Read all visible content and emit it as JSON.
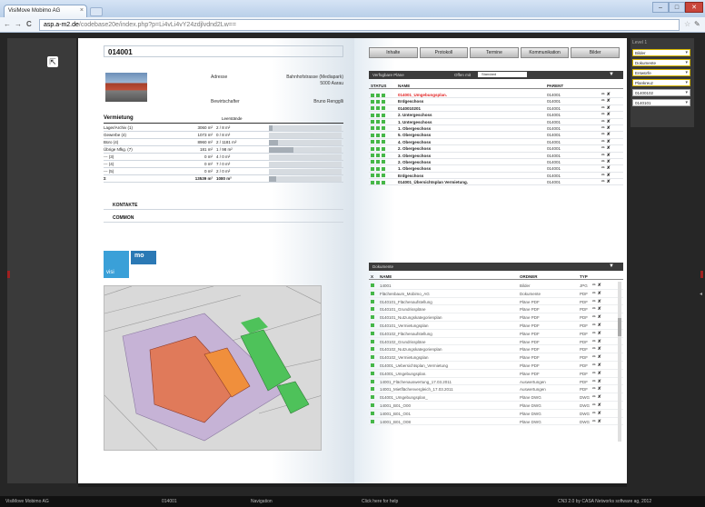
{
  "browser": {
    "tab_title": "VisiMove Mobimo AG",
    "tab_close": "×",
    "url_host": "asp.a-m2.de",
    "url_path": "/codebase20e/index.php?p=Li4vLi4vY24zdjlvdnd2Lw==",
    "back": "←",
    "forward": "→",
    "reload": "C",
    "star": "☆",
    "wrench": "✎",
    "win_min": "–",
    "win_max": "□",
    "win_close": "✕"
  },
  "left": {
    "cursor_icon": "⇱",
    "object_id": "014001",
    "address_label": "Adresse",
    "address_line1": "Bahnhofstrasse (Mediapark)",
    "address_line2": "5000 Aarau",
    "manager_label": "Bewirtschafter",
    "manager_value": "Bruno Rengglli",
    "vermietung_title": "Vermietung",
    "leerstaende_label": "Leerstände",
    "rows": [
      {
        "label": "Lager/Archiv (1)",
        "area": "3060 m²",
        "ratio": "2 / 8 m²",
        "fill": 0.05
      },
      {
        "label": "Gewerbe (4)",
        "area": "1073 m²",
        "ratio": "0 / 8 m²",
        "fill": 0.0
      },
      {
        "label": "Büro (4)",
        "area": "8960 m²",
        "ratio": "2 / 1181 m²",
        "fill": 0.12
      },
      {
        "label": "Übrige Nfkg. (7)",
        "area": "181 m²",
        "ratio": "1 / 98 m²",
        "fill": 0.34
      },
      {
        "label": "--- (3)",
        "area": "0 m²",
        "ratio": "4 / 0 m²",
        "fill": 0.0
      },
      {
        "label": "--- (4)",
        "area": "0 m²",
        "ratio": "7 / 0 m²",
        "fill": 0.0
      },
      {
        "label": "--- (5)",
        "area": "0 m²",
        "ratio": "2 / 0 m²",
        "fill": 0.0
      }
    ],
    "total": {
      "label": "Σ",
      "area": "13539 m²",
      "ratio": "1080 m²",
      "fill": 0.1
    },
    "kontakte": "KONTAKTE",
    "common": "COMMON",
    "logo_top": "mo",
    "logo_bottom": "visi"
  },
  "toolbar": [
    "Inhalte",
    "Protokoll",
    "Termine",
    "Kommunikation",
    "Bilder"
  ],
  "plans_panel": {
    "title": "Verfügbare Pläne",
    "filter_label": "Offen mit",
    "filter_value": "Standard",
    "dropdown": "▼",
    "col_status": "STATUS",
    "col_name": "NAME",
    "col_parent": "PARENT",
    "rows": [
      {
        "name": "014001_Umgebungsplan.",
        "parent": "014001",
        "red": true
      },
      {
        "name": "Erdgeschoss",
        "parent": "014001",
        "red": false
      },
      {
        "name": "0140010201",
        "parent": "014001",
        "red": false
      },
      {
        "name": "2. Untergeschoss",
        "parent": "014001",
        "red": false
      },
      {
        "name": "1. Untergeschoss",
        "parent": "014001",
        "red": false
      },
      {
        "name": "1. Obergeschoss",
        "parent": "014001",
        "red": false
      },
      {
        "name": "5. Obergeschoss",
        "parent": "014001",
        "red": false
      },
      {
        "name": "4. Obergeschoss",
        "parent": "014001",
        "red": false
      },
      {
        "name": "2. Obergeschoss",
        "parent": "014001",
        "red": false
      },
      {
        "name": "3. Obergeschoss",
        "parent": "014001",
        "red": false
      },
      {
        "name": "2. Obergeschoss",
        "parent": "014001",
        "red": false
      },
      {
        "name": "1. Obergeschoss",
        "parent": "014001",
        "red": false
      },
      {
        "name": "Erdgeschoss",
        "parent": "014001",
        "red": false
      },
      {
        "name": "014001_Übersichtsplan Vermietung.",
        "parent": "014001",
        "red": false
      }
    ],
    "action": "✏ ✘"
  },
  "docs_panel": {
    "title": "Dokumente",
    "dropdown": "▼",
    "col_x": "X",
    "col_name": "NAME",
    "col_ordner": "ORDNER",
    "col_typ": "TYP",
    "rows": [
      {
        "name": "14001",
        "ordner": "Bilder",
        "typ": "JPG"
      },
      {
        "name": "Flächenbaum_Mobimo_AG",
        "ordner": "Dokumente",
        "typ": "PDF"
      },
      {
        "name": "0140101_Flächenaufstellung",
        "ordner": "Pläne PDF",
        "typ": "PDF"
      },
      {
        "name": "0140101_Grundrisspläne",
        "ordner": "Pläne PDF",
        "typ": "PDF"
      },
      {
        "name": "0140101_Nutzungskategorienplan",
        "ordner": "Pläne PDF",
        "typ": "PDF"
      },
      {
        "name": "0140101_Vermietungsplan",
        "ordner": "Pläne PDF",
        "typ": "PDF"
      },
      {
        "name": "0140102_Flächenaufstellung",
        "ordner": "Pläne PDF",
        "typ": "PDF"
      },
      {
        "name": "0140102_Grundrisspläne",
        "ordner": "Pläne PDF",
        "typ": "PDF"
      },
      {
        "name": "0140102_Nutzungskategorienplan",
        "ordner": "Pläne PDF",
        "typ": "PDF"
      },
      {
        "name": "0140102_Vermietungsplan",
        "ordner": "Pläne PDF",
        "typ": "PDF"
      },
      {
        "name": "014001_Uebersichtsplan_Vermietung",
        "ordner": "Pläne PDF",
        "typ": "PDF"
      },
      {
        "name": "014001_Umgebungsplan.",
        "ordner": "Pläne PDF",
        "typ": "PDF"
      },
      {
        "name": "14001_Flächenauswertung_17.03.2011",
        "ordner": "Auswertungen",
        "typ": "PDF"
      },
      {
        "name": "14001_Mietflächenvergleich_17.03.2011",
        "ordner": "Auswertungen",
        "typ": "PDF"
      },
      {
        "name": "014001_Umgebungsplan_",
        "ordner": "Pläne DWG",
        "typ": "DWG"
      },
      {
        "name": "14001_B01_O00",
        "ordner": "Pläne DWG",
        "typ": "DWG"
      },
      {
        "name": "14001_B01_O01",
        "ordner": "Pläne DWG",
        "typ": "DWG"
      },
      {
        "name": "14001_B01_O08",
        "ordner": "Pläne DWG",
        "typ": "DWG"
      }
    ],
    "action": "✏ ✘"
  },
  "right_panel": {
    "title": "Level 1",
    "selects": [
      "Bilder",
      "Dokumente",
      "Entwürfe",
      "Plankreuz",
      "01400102",
      "0140101"
    ],
    "arrow": "▾"
  },
  "status": {
    "company": "VisiMove Mobimo AG",
    "object": "014001",
    "nav": "Navigation",
    "help": "Click here for help",
    "version": "CN3 2.0 by CASA Networks software ag, 2012"
  },
  "colors": {
    "status_green": "#46b748",
    "highlight_red": "#e21f1f",
    "logo_blue": "#3aa0d8",
    "select_border": "#d4b400"
  }
}
